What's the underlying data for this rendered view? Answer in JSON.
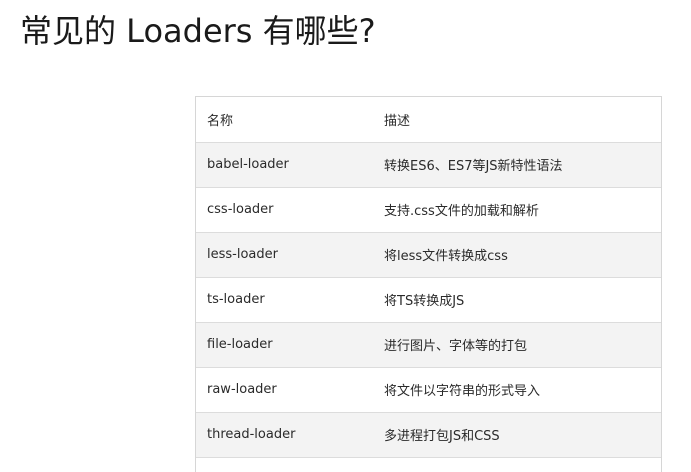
{
  "page": {
    "title": "常见的 Loaders 有哪些?"
  },
  "table": {
    "headers": [
      "名称",
      "描述"
    ],
    "rows": [
      [
        "babel-loader",
        "转换ES6、ES7等JS新特性语法"
      ],
      [
        "css-loader",
        "支持.css文件的加载和解析"
      ],
      [
        "less-loader",
        "将less文件转换成css"
      ],
      [
        "ts-loader",
        "将TS转换成JS"
      ],
      [
        "file-loader",
        "进行图片、字体等的打包"
      ],
      [
        "raw-loader",
        "将文件以字符串的形式导入"
      ],
      [
        "thread-loader",
        "多进程打包JS和CSS"
      ]
    ]
  }
}
